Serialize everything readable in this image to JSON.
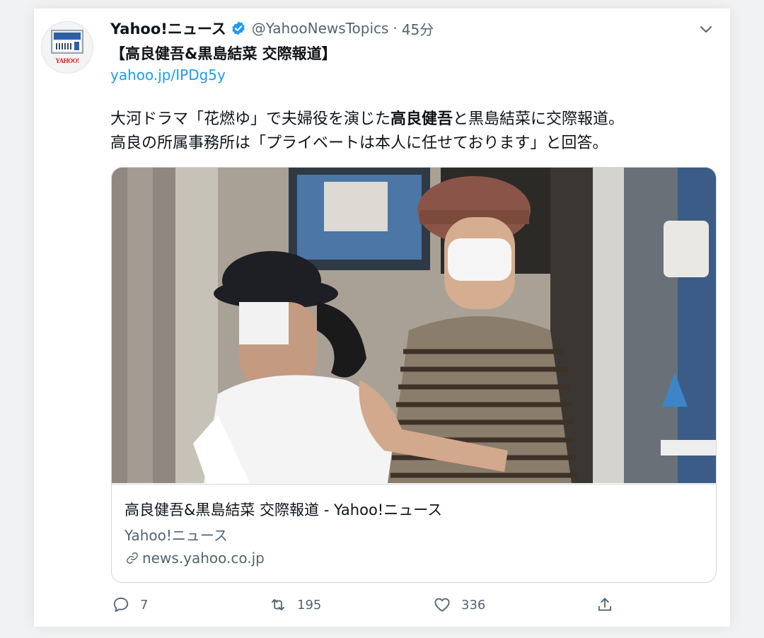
{
  "tweet": {
    "display_name": "Yahoo!ニュース",
    "handle": "@YahooNewsTopics",
    "separator": "·",
    "time": "45分",
    "avatar_text": "YAHOO!",
    "title": "【高良健吾&黒島結菜 交際報道】",
    "link": "yahoo.jp/IPDg5y",
    "body": {
      "line1_a": "大河ドラマ「花燃ゆ」で夫婦役を演じた",
      "line1_bold": "高良健吾",
      "line1_b": "と黒島結菜に交際報道。",
      "line2": "高良の所属事務所は「プライベートは本人に任せております」と回答。"
    }
  },
  "link_card": {
    "title": "高良健吾&黒島結菜 交際報道 - Yahoo!ニュース",
    "source": "Yahoo!ニュース",
    "domain": "news.yahoo.co.jp"
  },
  "actions": {
    "reply_count": "7",
    "retweet_count": "195",
    "like_count": "336"
  },
  "icons": {
    "verified": "verified-badge-icon",
    "more": "chevron-down-icon",
    "link": "link-icon",
    "reply": "reply-icon",
    "retweet": "retweet-icon",
    "like": "heart-icon",
    "share": "share-icon"
  },
  "colors": {
    "accent": "#1d9bf0",
    "text_secondary": "#536471",
    "border": "#cfd9de"
  }
}
